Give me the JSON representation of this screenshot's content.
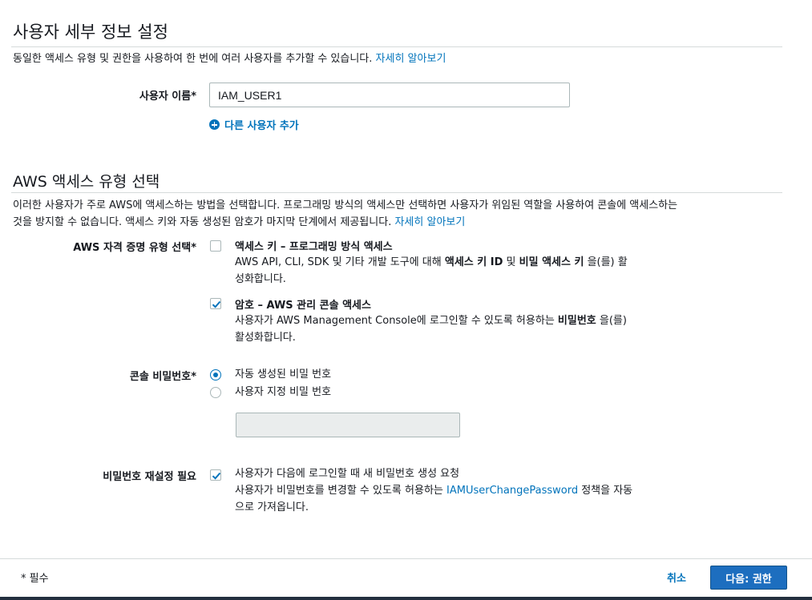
{
  "details": {
    "title": "사용자 세부 정보 설정",
    "desc": "동일한 액세스 유형 및 권한을 사용하여 한 번에 여러 사용자를 추가할 수 있습니다.",
    "learn_more": "자세히 알아보기",
    "username_label": "사용자 이름*",
    "username_value": "IAM_USER1",
    "add_user": "다른 사용자 추가"
  },
  "access": {
    "title": "AWS 액세스 유형 선택",
    "desc_line1": "이러한 사용자가 주로 AWS에 액세스하는 방법을 선택합니다. 프로그래밍 방식의 액세스만 선택하면 사용자가 위임된 역할을 사용하여 콘솔에 액세스하는",
    "desc_line2": "것을 방지할 수 없습니다. 액세스 키와 자동 생성된 암호가 마지막 단계에서 제공됩니다.",
    "learn_more": "자세히 알아보기",
    "credential_label": "AWS 자격 증명 유형 선택*",
    "opt1": {
      "title": "액세스 키 – 프로그래밍 방식 액세스",
      "line1_a": "AWS API, CLI, SDK 및 기타 개발 도구에 대해 ",
      "line1_b": "액세스 키 ID",
      "line1_c": " 및 ",
      "line1_d": "비밀 액세스 키",
      "line1_e": " 을(를) 활",
      "line2": "성화합니다.",
      "checked": false
    },
    "opt2": {
      "title": "암호 – AWS 관리 콘솔 액세스",
      "line1_a": "사용자가 AWS Management Console에 로그인할 수 있도록 허용하는 ",
      "line1_b": "비밀번호",
      "line1_c": " 을(를)",
      "line2": "활성화합니다.",
      "checked": true
    },
    "console_pw_label": "콘솔 비밀번호*",
    "radio_auto": "자동 생성된 비밀 번호",
    "radio_custom": "사용자 지정 비밀 번호",
    "reset_label": "비밀번호 재설정 필요",
    "reset_line1": "사용자가 다음에 로그인할 때 새 비밀번호 생성 요청",
    "reset_line2_a": "사용자가 비밀번호를 변경할 수 있도록 허용하는 ",
    "reset_line2_link": "IAMUserChangePassword",
    "reset_line2_b": " 정책을 자동",
    "reset_line3": "으로 가져옵니다."
  },
  "footer": {
    "required": "* 필수",
    "cancel": "취소",
    "next": "다음: 권한"
  },
  "colors": {
    "accent": "#0073bb",
    "primary_button": "#1d6ebf"
  }
}
